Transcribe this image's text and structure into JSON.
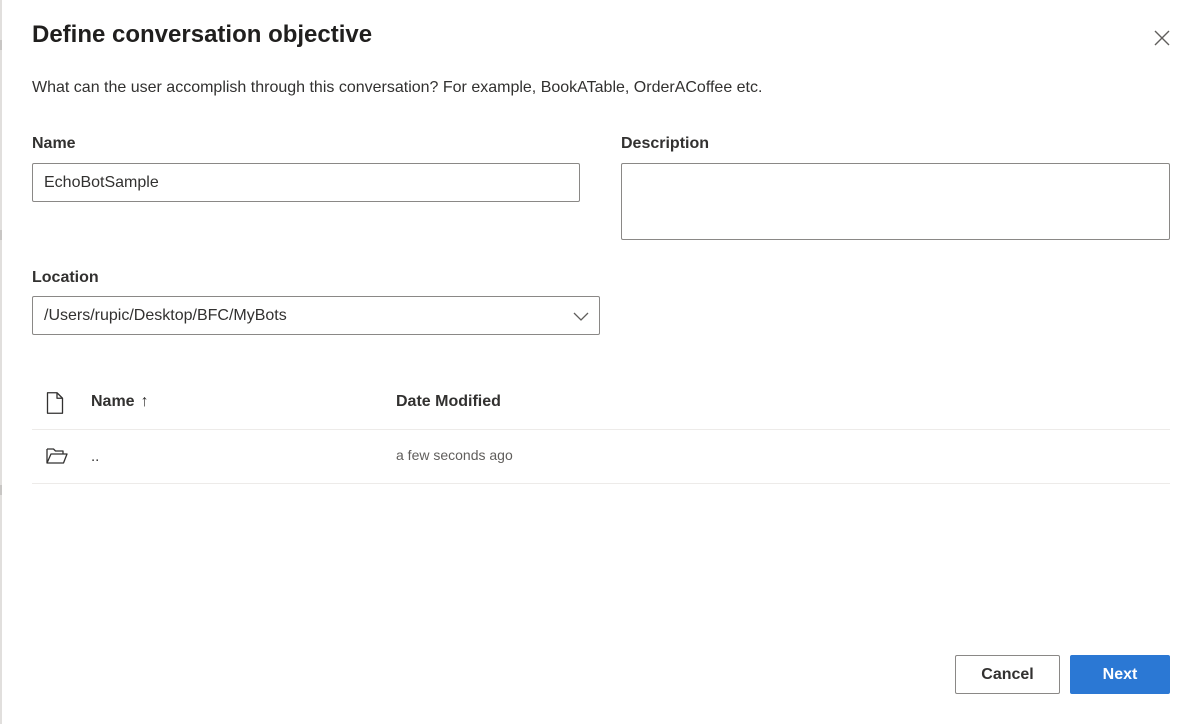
{
  "dialog": {
    "title": "Define conversation objective",
    "subtitle": "What can the user accomplish through this conversation? For example, BookATable, OrderACoffee etc."
  },
  "form": {
    "name_label": "Name",
    "name_value": "EchoBotSample",
    "description_label": "Description",
    "description_value": "",
    "location_label": "Location",
    "location_value": "/Users/rupic/Desktop/BFC/MyBots"
  },
  "file_list": {
    "columns": {
      "file_type_icon": "document-icon",
      "name": "Name",
      "sort_indicator": "↑",
      "date_modified": "Date Modified"
    },
    "rows": [
      {
        "icon": "folder-open-icon",
        "name": "..",
        "date_modified": "a few seconds ago"
      }
    ]
  },
  "actions": {
    "cancel_label": "Cancel",
    "next_label": "Next"
  },
  "colors": {
    "primary": "#2b78d4",
    "border": "#8a8886",
    "divider": "#edebe9",
    "text": "#323130"
  }
}
